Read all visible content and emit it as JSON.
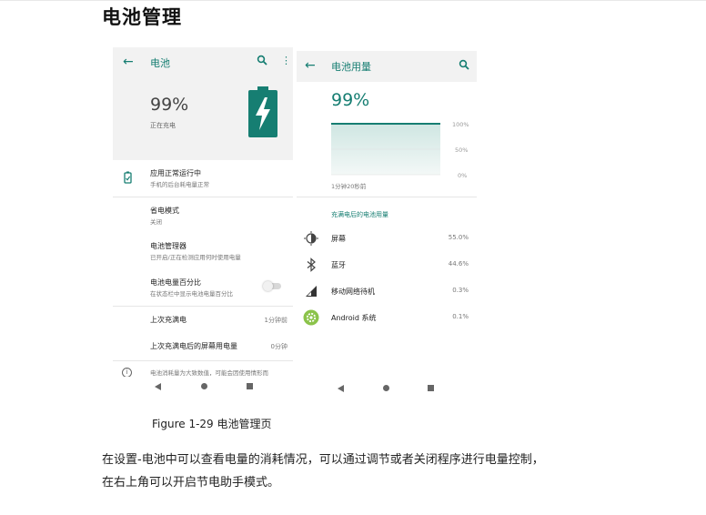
{
  "doc": {
    "title": "电池管理",
    "caption": "Figure 1-29 电池管理页",
    "paragraph_line1": "在设置-电池中可以查看电量的消耗情况，可以通过调节或者关闭程序进行电量控制，",
    "paragraph_line2": "在右上角可以开启节电助手模式。"
  },
  "colors": {
    "accent": "#167e72",
    "app_icon_green": "#8bc34a"
  },
  "battery_screen": {
    "back_icon": "arrow-left-icon",
    "title": "电池",
    "search_icon": "search-icon",
    "more_icon": "more-vert-icon",
    "level": "99%",
    "status": "正在充电",
    "battery_icon": "battery-charging-icon",
    "rows": [
      {
        "title": "应用正常运行中",
        "subtitle": "手机的后台耗电量正常",
        "icon": "battery-ok-icon"
      },
      {
        "title": "省电模式",
        "subtitle": "关闭"
      },
      {
        "title": "电池管理器",
        "subtitle": "已开启/正在检测应用何时使用电量"
      },
      {
        "title": "电池电量百分比",
        "subtitle": "在状态栏中显示电池电量百分比",
        "toggle_on": false
      },
      {
        "title": "上次充满电",
        "value": "1分钟前"
      },
      {
        "title": "上次充满电后的屏幕用电量",
        "value": "0分钟"
      }
    ],
    "info_text": "电池消耗量为大致数值，可能会因使用情形而",
    "info_icon": "info-icon"
  },
  "usage_screen": {
    "back_icon": "arrow-left-icon",
    "title": "电池用量",
    "search_icon": "search-icon",
    "level": "99%",
    "chart_ticks": [
      "100%",
      "50%",
      "0%"
    ],
    "since_label": "1分钟20秒前",
    "section_label": "充满电后的电池用量",
    "apps": [
      {
        "name": "屏幕",
        "percent": "55.0%",
        "icon": "brightness-icon"
      },
      {
        "name": "蓝牙",
        "percent": "44.6%",
        "icon": "bluetooth-icon"
      },
      {
        "name": "移动网络待机",
        "percent": "0.3%",
        "icon": "signal-icon"
      },
      {
        "name": "Android 系统",
        "percent": "0.1%",
        "icon": "android-settings-icon"
      }
    ]
  },
  "nav_icons": [
    "nav-back-icon",
    "nav-home-icon",
    "nav-recent-icon"
  ]
}
